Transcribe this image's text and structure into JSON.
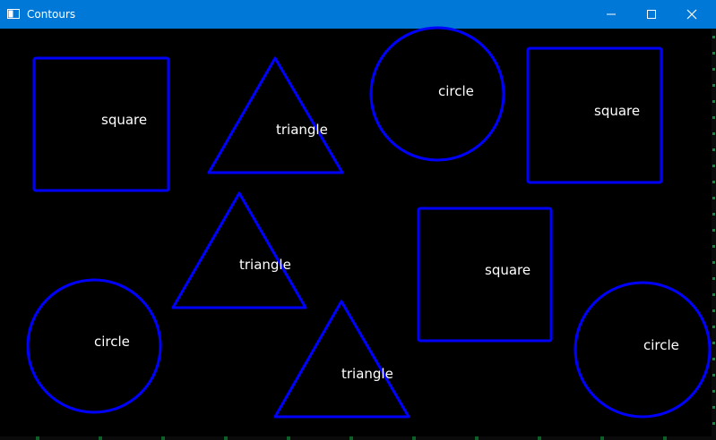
{
  "window": {
    "title": "Contours",
    "controls": {
      "minimize_icon": "minimize-icon",
      "maximize_icon": "maximize-icon",
      "close_icon": "close-icon"
    },
    "colors": {
      "titlebar": "#0078d7",
      "background": "#000000",
      "contour": "#0000ff",
      "label": "#ffffff"
    }
  },
  "labels": [
    "square",
    "triangle",
    "circle",
    "square",
    "triangle",
    "square",
    "circle",
    "triangle",
    "circle"
  ]
}
